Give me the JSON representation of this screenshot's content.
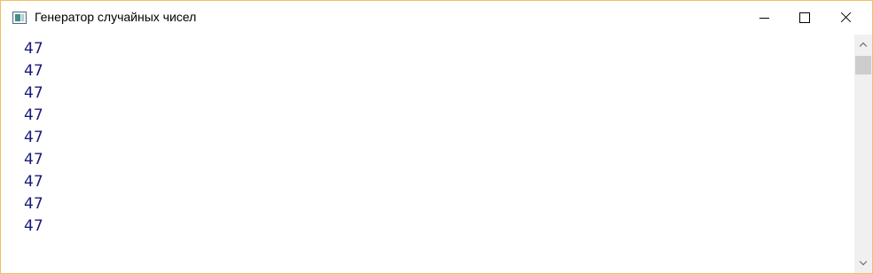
{
  "window": {
    "title": "Генератор случайных чисел"
  },
  "titlebar_buttons": {
    "minimize_icon": "minimize-icon",
    "maximize_icon": "maximize-icon",
    "close_icon": "close-icon"
  },
  "content": {
    "numbers": [
      "47",
      "47",
      "47",
      "47",
      "47",
      "47",
      "47",
      "47",
      "47"
    ]
  },
  "colors": {
    "number_text": "#1a1a7a",
    "window_border": "#f0c060",
    "scrollbar_track": "#f0f0f0",
    "scrollbar_thumb": "#cdcdcd"
  }
}
